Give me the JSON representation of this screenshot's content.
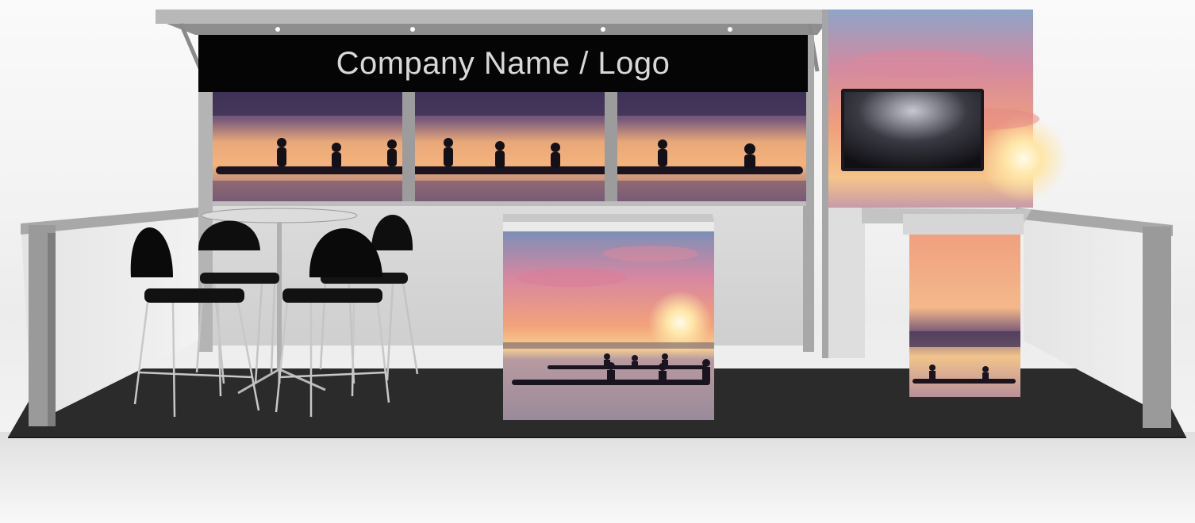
{
  "booth": {
    "header_text": "Company Name / Logo"
  },
  "colors": {
    "carpet": "#2b2b2b",
    "frame": "#9a9a9a",
    "wall": "#d9d9d9",
    "header_bg": "#050505",
    "sunset_orange": "#f4a46a",
    "sunset_pink": "#d98a9a",
    "sunset_purple": "#4a3a60"
  },
  "objects": [
    "header-sign",
    "back-wall-rowing-graphic",
    "tower-sunset-graphic",
    "tv-monitor",
    "reception-counter",
    "kiosk-counter",
    "cafe-table",
    "bar-stools",
    "side-rails",
    "carpet"
  ]
}
